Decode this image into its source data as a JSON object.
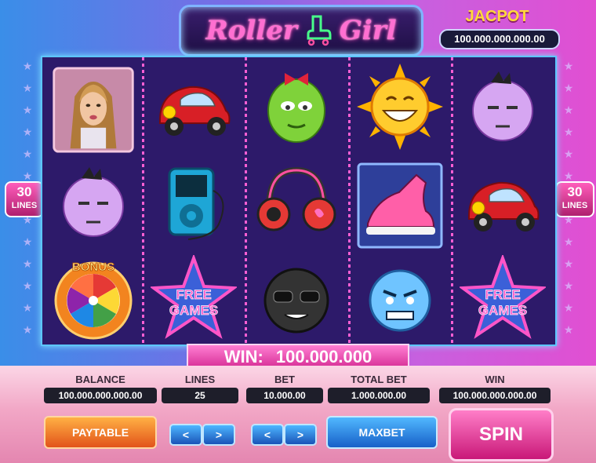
{
  "logo": {
    "word1": "Roller",
    "word2": "Girl"
  },
  "jackpot": {
    "title": "JACPOT",
    "value": "100.000.000.000.00"
  },
  "lines_badge": {
    "number": "30",
    "label": "LINES"
  },
  "reels": [
    [
      "girl-portrait",
      "bonus-wheel"
    ],
    [
      "red-beetle-car",
      "music-player",
      "free-games-star"
    ],
    [
      "green-face-with-bow",
      "headphones",
      "black-face-sunglasses"
    ],
    [
      "sun-face",
      "sneaker",
      "blue-angry-face"
    ],
    [
      "purple-bored-face",
      "red-beetle-car",
      "free-games-star"
    ]
  ],
  "symbols": {
    "bonus_text": "BONUS",
    "free_games_line1": "FREE",
    "free_games_line2": "GAMES"
  },
  "win_banner": {
    "label": "WIN:",
    "value": "100.000.000"
  },
  "stats": {
    "balance": {
      "label": "BALANCE",
      "value": "100.000.000.000.00"
    },
    "lines": {
      "label": "LINES",
      "value": "25"
    },
    "bet": {
      "label": "BET",
      "value": "10.000.00"
    },
    "total_bet": {
      "label": "TOTAL BET",
      "value": "1.000.000.00"
    },
    "win": {
      "label": "WIN",
      "value": "100.000.000.000.00"
    }
  },
  "buttons": {
    "paytable": "PAYTABLE",
    "lines_down": "<",
    "lines_up": ">",
    "bet_down": "<",
    "bet_up": ">",
    "maxbet": "MAXBET",
    "spin": "SPIN"
  },
  "colors": {
    "reel_bg": "#2d1a6a",
    "separator": "#ff5fd4",
    "jackpot_title": "#ffd93a",
    "spin_button": "#e0399c"
  }
}
